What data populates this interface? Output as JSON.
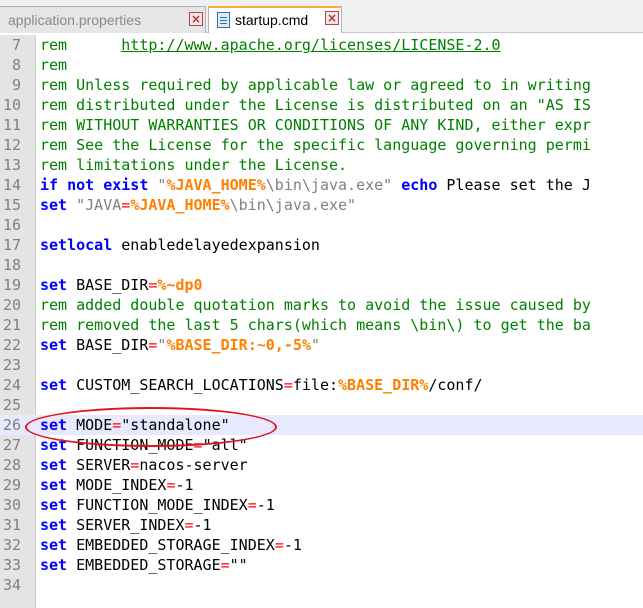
{
  "tabs": [
    {
      "label": "application.properties",
      "active": false
    },
    {
      "label": "startup.cmd",
      "active": true
    }
  ],
  "colors": {
    "keyword": "#0000ff",
    "comment": "#008000",
    "operator": "#ff0000",
    "variable": "#ff8000",
    "text": "#000000",
    "current_line": "#e8e8ff",
    "highlight_ellipse": "#e0141e"
  },
  "annotation": {
    "type": "ellipse",
    "target_line": 26
  },
  "lines": [
    {
      "n": "7",
      "segs": [
        [
          "cm",
          "rem      "
        ],
        [
          "url",
          "http://www.apache.org/licenses/LICENSE-2.0"
        ]
      ]
    },
    {
      "n": "8",
      "segs": [
        [
          "cm",
          "rem"
        ]
      ]
    },
    {
      "n": "9",
      "segs": [
        [
          "cm",
          "rem Unless required by applicable law or agreed to in writing"
        ]
      ]
    },
    {
      "n": "10",
      "segs": [
        [
          "cm",
          "rem distributed under the License is distributed on an \"AS IS"
        ]
      ]
    },
    {
      "n": "11",
      "segs": [
        [
          "cm",
          "rem WITHOUT WARRANTIES OR CONDITIONS OF ANY KIND, either expr"
        ]
      ]
    },
    {
      "n": "12",
      "segs": [
        [
          "cm",
          "rem See the License for the specific language governing permi"
        ]
      ]
    },
    {
      "n": "13",
      "segs": [
        [
          "cm",
          "rem limitations under the License."
        ]
      ]
    },
    {
      "n": "14",
      "segs": [
        [
          "kw",
          "if not exist"
        ],
        [
          "txt",
          " "
        ],
        [
          "str",
          "\""
        ],
        [
          "var",
          "%JAVA_HOME%"
        ],
        [
          "str",
          "\\bin\\java.exe\""
        ],
        [
          "txt",
          " "
        ],
        [
          "kw",
          "echo"
        ],
        [
          "txt",
          " Please set the J"
        ]
      ]
    },
    {
      "n": "15",
      "segs": [
        [
          "kw",
          "set"
        ],
        [
          "txt",
          " "
        ],
        [
          "str",
          "\"JAVA"
        ],
        [
          "op",
          "="
        ],
        [
          "var",
          "%JAVA_HOME%"
        ],
        [
          "str",
          "\\bin\\java.exe\""
        ]
      ]
    },
    {
      "n": "16",
      "segs": []
    },
    {
      "n": "17",
      "segs": [
        [
          "kw",
          "setlocal"
        ],
        [
          "txt",
          " enabledelayedexpansion"
        ]
      ]
    },
    {
      "n": "18",
      "segs": []
    },
    {
      "n": "19",
      "segs": [
        [
          "kw",
          "set"
        ],
        [
          "txt",
          " BASE_DIR"
        ],
        [
          "op",
          "="
        ],
        [
          "var",
          "%~dp0"
        ]
      ]
    },
    {
      "n": "20",
      "segs": [
        [
          "cm",
          "rem added double quotation marks to avoid the issue caused by"
        ]
      ]
    },
    {
      "n": "21",
      "segs": [
        [
          "cm",
          "rem removed the last 5 chars(which means \\bin\\) to get the ba"
        ]
      ]
    },
    {
      "n": "22",
      "segs": [
        [
          "kw",
          "set"
        ],
        [
          "txt",
          " BASE_DIR"
        ],
        [
          "op",
          "="
        ],
        [
          "str",
          "\""
        ],
        [
          "var",
          "%BASE_DIR:~0,-5%"
        ],
        [
          "str",
          "\""
        ]
      ]
    },
    {
      "n": "23",
      "segs": []
    },
    {
      "n": "24",
      "segs": [
        [
          "kw",
          "set"
        ],
        [
          "txt",
          " CUSTOM_SEARCH_LOCATIONS"
        ],
        [
          "op",
          "="
        ],
        [
          "txt",
          "file:"
        ],
        [
          "var",
          "%BASE_DIR%"
        ],
        [
          "txt",
          "/conf/"
        ]
      ]
    },
    {
      "n": "25",
      "segs": []
    },
    {
      "n": "26",
      "current": true,
      "segs": [
        [
          "kw",
          "set"
        ],
        [
          "txt",
          " MODE"
        ],
        [
          "op",
          "="
        ],
        [
          "txt",
          "\"standalone\""
        ]
      ]
    },
    {
      "n": "27",
      "segs": [
        [
          "kw",
          "set"
        ],
        [
          "txt",
          " FUNCTION_MODE"
        ],
        [
          "op",
          "="
        ],
        [
          "txt",
          "\"all\""
        ]
      ]
    },
    {
      "n": "28",
      "segs": [
        [
          "kw",
          "set"
        ],
        [
          "txt",
          " SERVER"
        ],
        [
          "op",
          "="
        ],
        [
          "txt",
          "nacos-server"
        ]
      ]
    },
    {
      "n": "29",
      "segs": [
        [
          "kw",
          "set"
        ],
        [
          "txt",
          " MODE_INDEX"
        ],
        [
          "op",
          "="
        ],
        [
          "txt",
          "-1"
        ]
      ]
    },
    {
      "n": "30",
      "segs": [
        [
          "kw",
          "set"
        ],
        [
          "txt",
          " FUNCTION_MODE_INDEX"
        ],
        [
          "op",
          "="
        ],
        [
          "txt",
          "-1"
        ]
      ]
    },
    {
      "n": "31",
      "segs": [
        [
          "kw",
          "set"
        ],
        [
          "txt",
          " SERVER_INDEX"
        ],
        [
          "op",
          "="
        ],
        [
          "txt",
          "-1"
        ]
      ]
    },
    {
      "n": "32",
      "segs": [
        [
          "kw",
          "set"
        ],
        [
          "txt",
          " EMBEDDED_STORAGE_INDEX"
        ],
        [
          "op",
          "="
        ],
        [
          "txt",
          "-1"
        ]
      ]
    },
    {
      "n": "33",
      "segs": [
        [
          "kw",
          "set"
        ],
        [
          "txt",
          " EMBEDDED_STORAGE"
        ],
        [
          "op",
          "="
        ],
        [
          "txt",
          "\"\""
        ]
      ]
    },
    {
      "n": "34",
      "segs": []
    }
  ]
}
